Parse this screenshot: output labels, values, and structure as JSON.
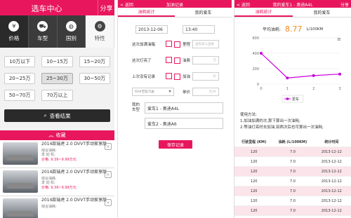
{
  "p1": {
    "title": "选车中心",
    "share": "分享",
    "tabs": [
      {
        "label": "价格",
        "icon": "yen-icon"
      },
      {
        "label": "车型",
        "icon": "car-icon"
      },
      {
        "label": "国别",
        "icon": "globe-icon"
      },
      {
        "label": "特性",
        "icon": "gear-icon"
      }
    ],
    "prices": [
      "10万以下",
      "10~15万",
      "15~20万",
      "20~25万",
      "25~30万",
      "30~50万",
      "50~70万",
      "70万以上"
    ],
    "selected_price": "25~30万",
    "view_btn": "查看结果",
    "collect": "收藏",
    "cars": [
      {
        "name": "2014款瑞虎 2.0 DVVT手动家享版",
        "l1": "综合油耗:",
        "l2": "发 动 机:",
        "l3": "变 速 箱:",
        "price": "价格: 9.39~9.99万元",
        "del": "×"
      },
      {
        "name": "2014款瑞虎 2.0 DVVT手动家享版",
        "l1": "综合油耗:",
        "l2": "发 动 机:",
        "l3": "变 速 箱:",
        "price": "价格: 9.39~9.99万元",
        "del": "×"
      },
      {
        "name": "2014款瑞虎 2.0 DVVT手动家享版",
        "l1": "综合油耗:",
        "l2": "发 动 机:",
        "l3": "变 速 箱:",
        "price": "价格: 9.39~9.99万元",
        "del": "×"
      }
    ]
  },
  "p2": {
    "back": "< 返回",
    "title": "加油记录",
    "tab_active": "油耗统计",
    "tab_other": "我的爱车",
    "date": "2013-12-06",
    "time": "13:40",
    "q1": "这次加满油箱",
    "q2": "这次灯亮了",
    "q3": "上次没有记录",
    "mileage_label": "里程",
    "mileage_ph": "里程表公里数",
    "fuel_label": "油费",
    "fuel_ph": "元",
    "gas_label": "加油",
    "gas_ph": "升",
    "fuel_type": "93#无铅汽油",
    "unit_price_label": "单价",
    "unit_price_ph": "元/升",
    "mycar_label": "我的车型",
    "car1": "爱车1 - 奥迪A4L",
    "car2": "爱车2 - 奥迪A6",
    "save": "保存记录"
  },
  "p3": {
    "back": "< 返回",
    "title": "我的爱车1 - 奥迪A4L",
    "share": "分享",
    "tab_active": "油耗统计",
    "tab_other": "我的爱车",
    "avg_label": "平均油耗:",
    "avg_value": "8.77",
    "avg_unit": "L/100KM",
    "legend": "爱车",
    "usage_title": "使用方法:",
    "usage1": "1.加油加满的次,那下算出一次油耗;",
    "usage2": "2.等油灯亮时去加油,如两次后也可算出一次油耗;",
    "columns": [
      "行驶里程 (KM)",
      "油耗 (L/100KM)",
      "统计时间"
    ],
    "rows": [
      [
        "120",
        "7.0",
        "2013-12-12"
      ],
      [
        "120",
        "7.0",
        "2013-12-12"
      ],
      [
        "120",
        "7.0",
        "2013-12-12"
      ],
      [
        "120",
        "7.0",
        "2013-12-12"
      ],
      [
        "120",
        "7.0",
        "2013-12-12"
      ],
      [
        "120",
        "7.0",
        "2013-12-12"
      ],
      [
        "120",
        "7.0",
        "2013-12-12"
      ]
    ]
  },
  "chart_data": {
    "type": "line",
    "x": [
      0,
      1,
      2,
      3
    ],
    "series": [
      {
        "name": "爱车",
        "values": [
          400,
          80,
          110,
          130
        ]
      }
    ],
    "ylim": [
      0,
      600
    ],
    "yticks": [
      0,
      200,
      400,
      600
    ],
    "xticks": [
      "0",
      "1",
      "2",
      "3"
    ],
    "color": "#c800e0"
  },
  "colors": {
    "accent": "#e8175d",
    "dark": "#3c3c3c"
  }
}
